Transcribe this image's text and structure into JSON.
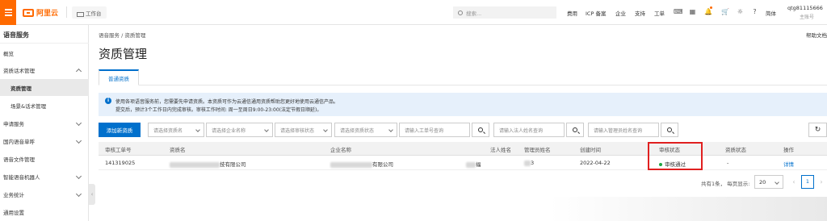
{
  "topbar": {
    "brand": "阿里云",
    "workbench": "工作台",
    "search_placeholder": "搜索...",
    "links": [
      "费用",
      "ICP 备案",
      "企业",
      "支持",
      "工单"
    ],
    "lang": "简体",
    "user_name": "qtg81115666",
    "user_role": "主账号"
  },
  "sidebar": {
    "title": "语音服务",
    "items": [
      {
        "label": "概览"
      },
      {
        "label": "资质话术管理"
      },
      {
        "label": "资质管理"
      },
      {
        "label": "场景&话术管理"
      },
      {
        "label": "申请服务"
      },
      {
        "label": "国内语音单呼"
      },
      {
        "label": "语音文件管理"
      },
      {
        "label": "智能语音机器人"
      },
      {
        "label": "业务统计"
      },
      {
        "label": "通用设置"
      }
    ]
  },
  "main": {
    "breadcrumb": "语音服务  /  资质管理",
    "help": "帮助文档",
    "title": "资质管理",
    "tab": "普通资质",
    "notice_line1": "使用各项语音服务前，您需要先申请资质。本资质可作为云通信通用资质帮助您更好地使用云通信产品。",
    "notice_line2": "提交后，预计3个工作日内完成审核。审核工作时间: 周一至周日9:00-23:00(法定节假日顺延)。",
    "add_button": "添加新资质",
    "filters": {
      "qual_name": "请选择资质名",
      "company": "请选择企业名称",
      "audit_status": "请选择审核状态",
      "qual_status": "请选择资质状态",
      "ticket_input": "请输入工单号查询",
      "legal_input": "请输入法人姓名查询",
      "admin_input": "请输入管理员姓名查询"
    }
  },
  "table": {
    "headers": [
      "审核工单号",
      "资质名",
      "企业名称",
      "法人姓名",
      "管理员姓名",
      "创建时间",
      "审核状态",
      "资质状态",
      "操作"
    ],
    "row": {
      "ticket": "141319025",
      "qual_suffix": "技有限公司",
      "company_suffix": "有限公司",
      "legal_suffix": "福",
      "admin_suffix": "3",
      "created": "2022-04-22",
      "audit_status": "审核通过",
      "qual_status": "-",
      "action": "详情"
    }
  },
  "pagination": {
    "summary": "共有1条， 每页显示:",
    "page_size": "20",
    "current_page": "1"
  },
  "colors": {
    "brand": "#ff6a00",
    "primary": "#0070cc",
    "success": "#1fa643",
    "highlight": "#e02020"
  }
}
